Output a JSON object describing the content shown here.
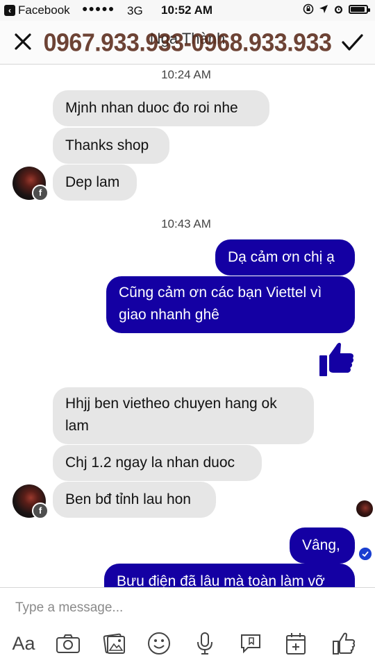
{
  "status_bar": {
    "back_app": "Facebook",
    "signal": "●●●●●",
    "network": "3G",
    "time": "10:52 AM",
    "battery_level": 0.9
  },
  "header": {
    "contact_name": "Nga Thành",
    "phone_overlay": "0967.933.933-0968.933.933"
  },
  "conversation": {
    "timestamp_1": "10:24 AM",
    "timestamp_2": "10:43 AM",
    "incoming_1": [
      "Mjnh nhan duoc đo roi nhe",
      "Thanks shop",
      "Dep lam"
    ],
    "outgoing_1": [
      "Dạ cảm ơn chị ạ",
      "Cũng cảm ơn các bạn Viettel vì giao nhanh ghê"
    ],
    "incoming_2": [
      "Hhjj ben vietheo chuyen hang ok lam",
      "Chj 1.2 ngay la nhan duoc",
      "Ben bđ tỉnh lau hon"
    ],
    "outgoing_2": [
      "Vâng,",
      "Bưu điện đã lâu mà toàn làm vỡ"
    ]
  },
  "composer": {
    "placeholder": "Type a message...",
    "aa_label": "Aa"
  },
  "colors": {
    "outgoing_bubble": "#1400a3",
    "incoming_bubble": "#e6e6e6",
    "like_thumb": "#1400a3"
  }
}
